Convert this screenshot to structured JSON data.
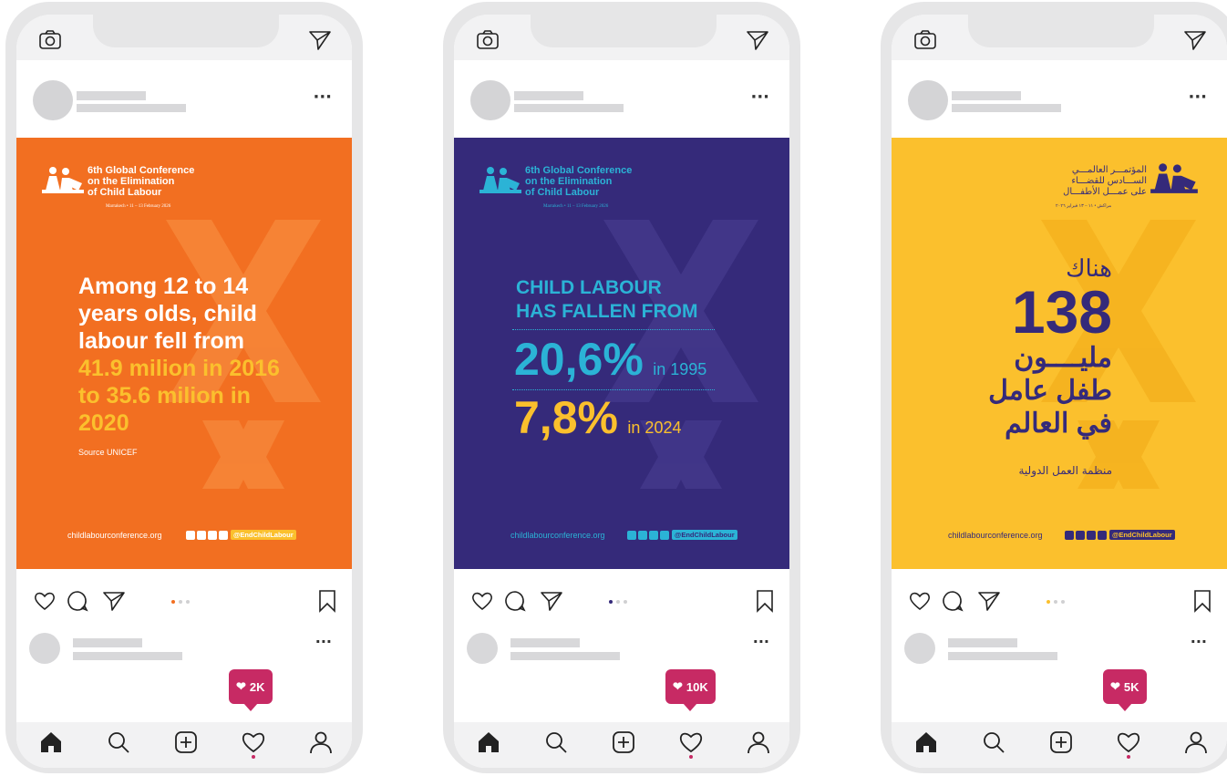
{
  "phones": [
    {
      "theme": {
        "bg": "#f26f21",
        "accent": "#fbc02d",
        "dot": "#f26f21"
      },
      "conference": {
        "title_lines": [
          "6th Global Conference",
          "on the Elimination",
          "of Child Labour"
        ],
        "date": "Marrakech • 11 – 13 February 2026"
      },
      "headline_lines": [
        "Among 12 to 14",
        "years olds, child",
        "labour fell from"
      ],
      "highlight_lines": [
        "41.9 milion in 2016",
        "to 35.6 milion in",
        "2020"
      ],
      "source": "Source UNICEF",
      "footer": {
        "url": "childlabourconference.org",
        "hashtag": "@EndChildLabour"
      },
      "likes": "2K"
    },
    {
      "theme": {
        "bg": "#352a7a",
        "accent": "#2bb3d6",
        "accent2": "#fbc02d",
        "dot": "#352a7a"
      },
      "conference": {
        "title_lines": [
          "6th Global Conference",
          "on the Elimination",
          "of Child Labour"
        ],
        "date": "Marrakech • 11 – 13 February 2026"
      },
      "headline_lines": [
        "CHILD LABOUR",
        "HAS FALLEN FROM"
      ],
      "stat1": {
        "value": "20,6%",
        "label": "in 1995"
      },
      "stat2": {
        "value": "7,8%",
        "label": "in 2024"
      },
      "footer": {
        "url": "childlabourconference.org",
        "hashtag": "@EndChildLabour"
      },
      "likes": "10K"
    },
    {
      "theme": {
        "bg": "#fbc02d",
        "accent": "#352a7a",
        "dot": "#fbc02d"
      },
      "conference": {
        "title_lines": [
          "المؤتمـــر العالمـــي",
          "الســـادس للقضـــاء",
          "على عمـــل الأطفـــال"
        ],
        "date": "مراكش • ١١ – ١٣ فبراير ٢٠٢٦"
      },
      "headline_lines": [
        "هناك",
        "138",
        "مليــــون",
        "طفل عامل",
        "في العالم"
      ],
      "source": "منظمة العمل الدولية",
      "footer": {
        "url": "childlabourconference.org",
        "hashtag": "@EndChildLabour"
      },
      "likes": "5K"
    }
  ]
}
